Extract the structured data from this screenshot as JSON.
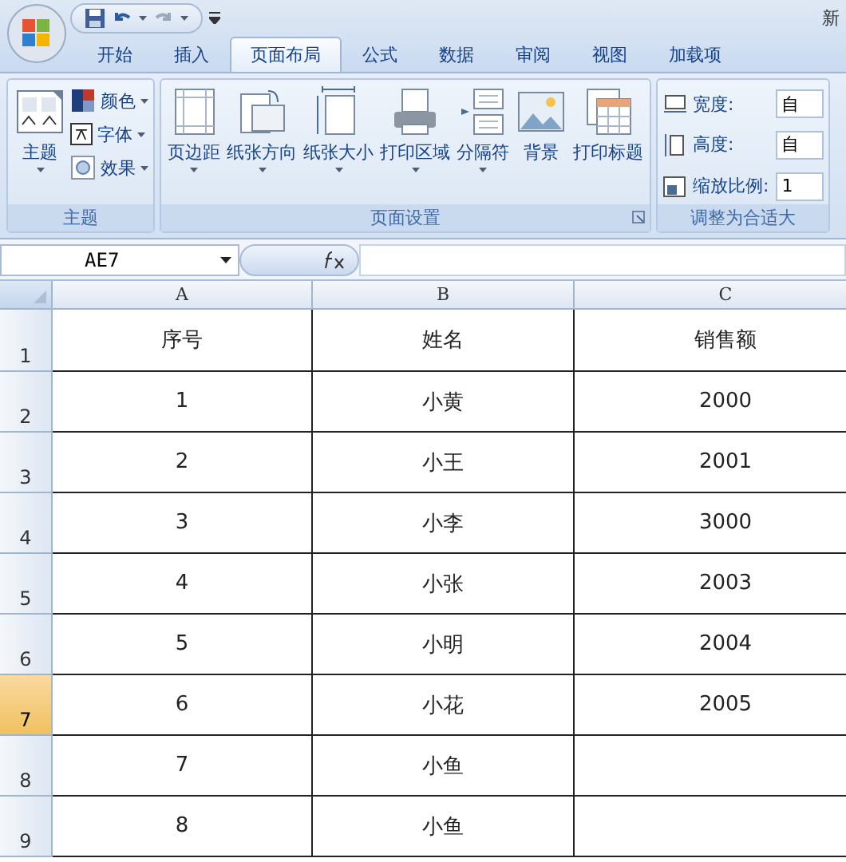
{
  "window": {
    "title": "新"
  },
  "tabs": [
    {
      "label": "开始",
      "selected": false
    },
    {
      "label": "插入",
      "selected": false
    },
    {
      "label": "页面布局",
      "selected": true
    },
    {
      "label": "公式",
      "selected": false
    },
    {
      "label": "数据",
      "selected": false
    },
    {
      "label": "审阅",
      "selected": false
    },
    {
      "label": "视图",
      "selected": false
    },
    {
      "label": "加载项",
      "selected": false
    }
  ],
  "ribbon_groups": [
    {
      "label": "主题",
      "launcher": false,
      "items": [
        {
          "kind": "large",
          "label": "主题",
          "dropdown": true
        },
        {
          "kind": "stack",
          "entries": [
            {
              "label": "颜色",
              "dropdown": true
            },
            {
              "label": "字体",
              "dropdown": true
            },
            {
              "label": "效果",
              "dropdown": true
            }
          ]
        }
      ]
    },
    {
      "label": "页面设置",
      "launcher": true,
      "items": [
        {
          "kind": "large",
          "label": "页边距",
          "dropdown": true
        },
        {
          "kind": "large",
          "label": "纸张方向",
          "dropdown": true
        },
        {
          "kind": "large",
          "label": "纸张大小",
          "dropdown": true
        },
        {
          "kind": "large",
          "label": "打印区域",
          "dropdown": true
        },
        {
          "kind": "large",
          "label": "分隔符",
          "dropdown": true
        },
        {
          "kind": "large",
          "label": "背景",
          "dropdown": false
        },
        {
          "kind": "large",
          "label": "打印标题",
          "dropdown": false
        }
      ]
    },
    {
      "label": "调整为合适大",
      "launcher": false,
      "items": [
        {
          "kind": "fields",
          "entries": [
            {
              "label": "宽度:",
              "value": "自"
            },
            {
              "label": "高度:",
              "value": "自"
            },
            {
              "label": "缩放比例:",
              "value": "1"
            }
          ]
        }
      ]
    }
  ],
  "name_box": "AE7",
  "columns": [
    "A",
    "B",
    "C"
  ],
  "rows": [
    {
      "number": "1",
      "selected": false,
      "cells": [
        "序号",
        "姓名",
        "销售额"
      ]
    },
    {
      "number": "2",
      "selected": false,
      "cells": [
        "1",
        "小黄",
        "2000"
      ]
    },
    {
      "number": "3",
      "selected": false,
      "cells": [
        "2",
        "小王",
        "2001"
      ]
    },
    {
      "number": "4",
      "selected": false,
      "cells": [
        "3",
        "小李",
        "3000"
      ]
    },
    {
      "number": "5",
      "selected": false,
      "cells": [
        "4",
        "小张",
        "2003"
      ]
    },
    {
      "number": "6",
      "selected": false,
      "cells": [
        "5",
        "小明",
        "2004"
      ]
    },
    {
      "number": "7",
      "selected": true,
      "cells": [
        "6",
        "小花",
        "2005"
      ]
    },
    {
      "number": "8",
      "selected": false,
      "cells": [
        "7",
        "小鱼"
      ]
    },
    {
      "number": "9",
      "selected": false,
      "cells": [
        "8",
        "小鱼"
      ]
    }
  ]
}
